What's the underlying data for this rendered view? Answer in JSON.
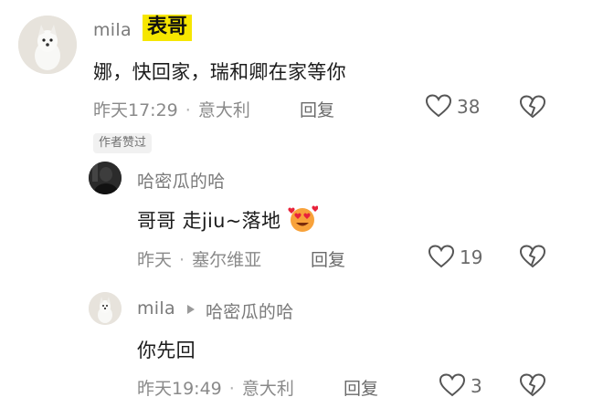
{
  "comments": [
    {
      "user": "mila",
      "tag": "表哥",
      "text": "娜，快回家，瑞和卿在家等你",
      "time": "昨天17:29",
      "location": "意大利",
      "reply_label": "回复",
      "likes": "38",
      "badge": "作者赞过"
    },
    {
      "user": "哈密瓜的哈",
      "text": "哥哥 走jiu~落地",
      "emoji": "heart-eyes-emoji",
      "time": "昨天",
      "location": "塞尔维亚",
      "reply_label": "回复",
      "likes": "19"
    },
    {
      "user": "mila",
      "reply_to": "哈密瓜的哈",
      "text": "你先回",
      "time": "昨天19:49",
      "location": "意大利",
      "reply_label": "回复",
      "likes": "3"
    }
  ],
  "icons": {
    "like": "heart-outline-icon",
    "dislike": "broken-heart-icon",
    "reply_arrow": "play-triangle-icon"
  },
  "colors": {
    "tag_bg": "#f6e600",
    "meta_text": "#8a8a8a",
    "name_text": "#7a7a7a"
  }
}
